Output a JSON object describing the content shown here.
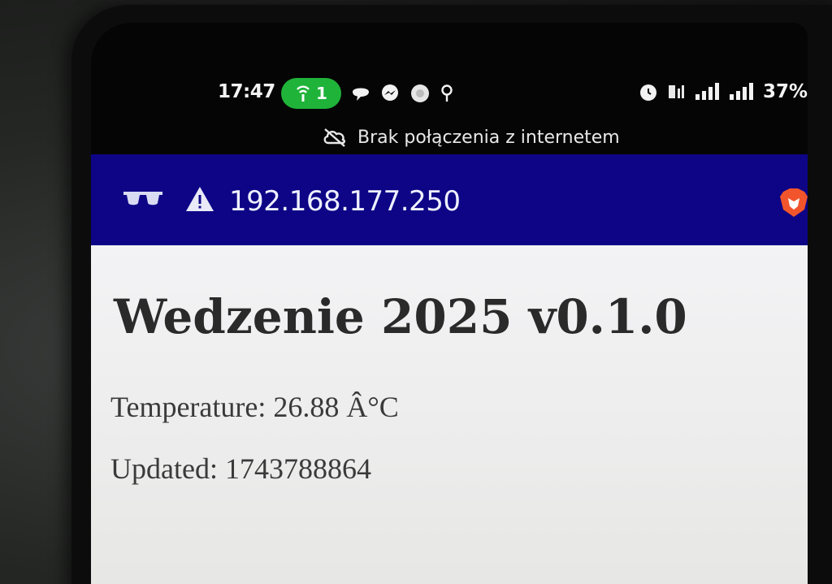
{
  "status_bar": {
    "time": "17:47",
    "hotspot_count": "1",
    "battery": "37%",
    "icons_left": [
      "hotspot-icon",
      "chat-bubble-icon",
      "messenger-icon",
      "app-notification-icon",
      "location-icon"
    ],
    "icons_right": [
      "alarm-icon",
      "volte-icon",
      "signal-icon",
      "signal-icon"
    ],
    "accent_color": "#1fb33a"
  },
  "connectivity": {
    "message": "Brak połączenia z internetem"
  },
  "browser": {
    "url": "192.168.177.250",
    "toolbar_color": "#0d0586",
    "icons": [
      "incognito-icon",
      "warning-icon",
      "brave-icon"
    ]
  },
  "page": {
    "heading": "Wedzenie 2025 v0.1.0",
    "temperature_label": "Temperature:",
    "temperature_value": "26.88 Â°C",
    "updated_label": "Updated:",
    "updated_value": "1743788864"
  }
}
